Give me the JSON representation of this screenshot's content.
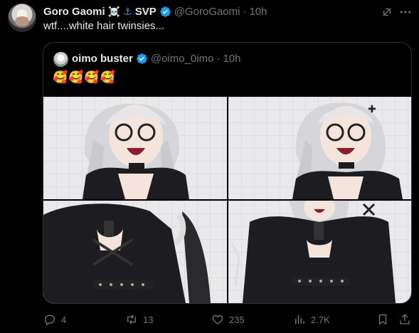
{
  "author": {
    "name": "Goro Gaomi",
    "badges": "☠️",
    "anchor": "⚓",
    "suffix": "SVP",
    "handle": "@GoroGaomi",
    "separator": "·",
    "time": "10h"
  },
  "tweet": {
    "text": "wtf....white hair twinsies..."
  },
  "quote": {
    "name": "oimo buster",
    "handle": "@oimo_0imo",
    "separator": "·",
    "time": "10h",
    "text": "🥰🥰🥰🥰",
    "images_count": 4
  },
  "actions": {
    "replies": "4",
    "reposts": "13",
    "likes": "235",
    "views": "2.7K"
  },
  "colors": {
    "background": "#000000",
    "text": "#e7e9ea",
    "muted": "#71767b",
    "border": "#2f3336",
    "verified": "#1d9bf0"
  },
  "icons": [
    "verified-icon",
    "grok-icon",
    "more-icon",
    "reply-icon",
    "repost-icon",
    "like-icon",
    "views-icon",
    "bookmark-icon",
    "share-icon"
  ]
}
